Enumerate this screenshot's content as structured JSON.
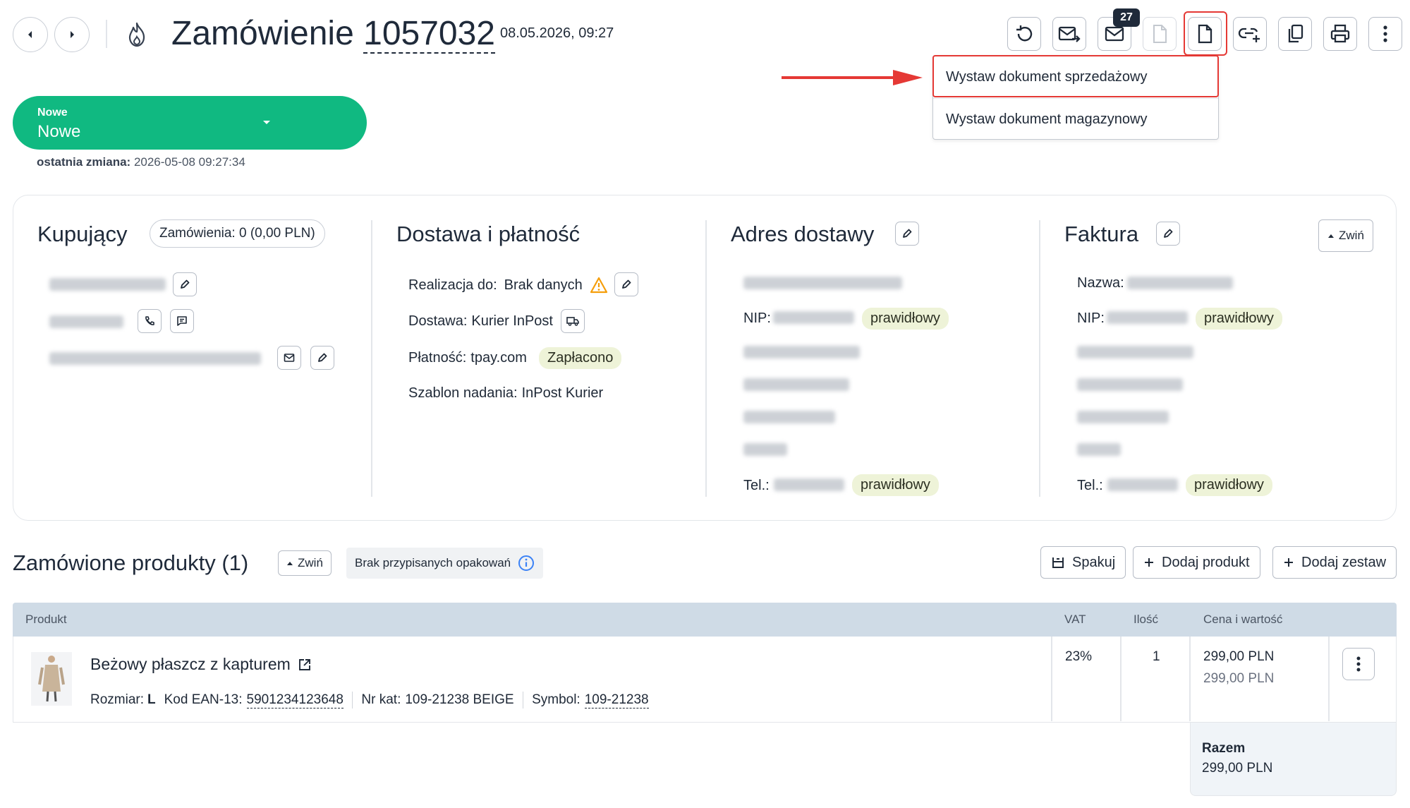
{
  "header": {
    "title_prefix": "Zamówienie",
    "order_number": "1057032",
    "datetime": "08.05.2026, 09:27",
    "mail_badge": "27"
  },
  "status": {
    "small_label": "Nowe",
    "value": "Nowe",
    "last_change_label": "ostatnia zmiana:",
    "last_change_value": "2026-05-08 09:27:34"
  },
  "dropdown": {
    "items": [
      "Wystaw dokument sprzedażowy",
      "Wystaw dokument magazynowy"
    ]
  },
  "buyer": {
    "title": "Kupujący",
    "orders_badge": "Zamówienia: 0 (0,00 PLN)"
  },
  "delivery": {
    "title": "Dostawa i płatność",
    "realization_label": "Realizacja do:",
    "realization_value": "Brak danych",
    "delivery_label": "Dostawa:",
    "delivery_value": "Kurier InPost",
    "payment_label": "Płatność:",
    "payment_value": "tpay.com",
    "payment_status": "Zapłacono",
    "template_label": "Szablon nadania:",
    "template_value": "InPost Kurier"
  },
  "address": {
    "title": "Adres dostawy",
    "nip_label": "NIP:",
    "nip_status": "prawidłowy",
    "tel_label": "Tel.:",
    "tel_status": "prawidłowy"
  },
  "invoice": {
    "title": "Faktura",
    "collapse_label": "Zwiń",
    "name_label": "Nazwa:",
    "nip_label": "NIP:",
    "nip_status": "prawidłowy",
    "tel_label": "Tel.:",
    "tel_status": "prawidłowy"
  },
  "products": {
    "title": "Zamówione produkty (1)",
    "collapse_label": "Zwiń",
    "packaging_note": "Brak przypisanych opakowań",
    "pack_button": "Spakuj",
    "add_product_button": "Dodaj produkt",
    "add_set_button": "Dodaj zestaw",
    "columns": {
      "product": "Produkt",
      "vat": "VAT",
      "qty": "Ilość",
      "price": "Cena i wartość"
    },
    "rows": [
      {
        "name": "Beżowy płaszcz z kapturem",
        "size_label": "Rozmiar:",
        "size_value": "L",
        "ean_label": "Kod EAN-13:",
        "ean_value": "5901234123648",
        "catalog_label": "Nr kat:",
        "catalog_value": "109-21238 BEIGE",
        "symbol_label": "Symbol:",
        "symbol_value": "109-21238",
        "vat": "23%",
        "qty": "1",
        "price": "299,00 PLN",
        "value": "299,00 PLN"
      }
    ],
    "total_label": "Razem",
    "total_value": "299,00 PLN"
  },
  "colors": {
    "status_green": "#10b981",
    "table_header": "#cfdbe6",
    "highlight_red": "#e53935"
  }
}
